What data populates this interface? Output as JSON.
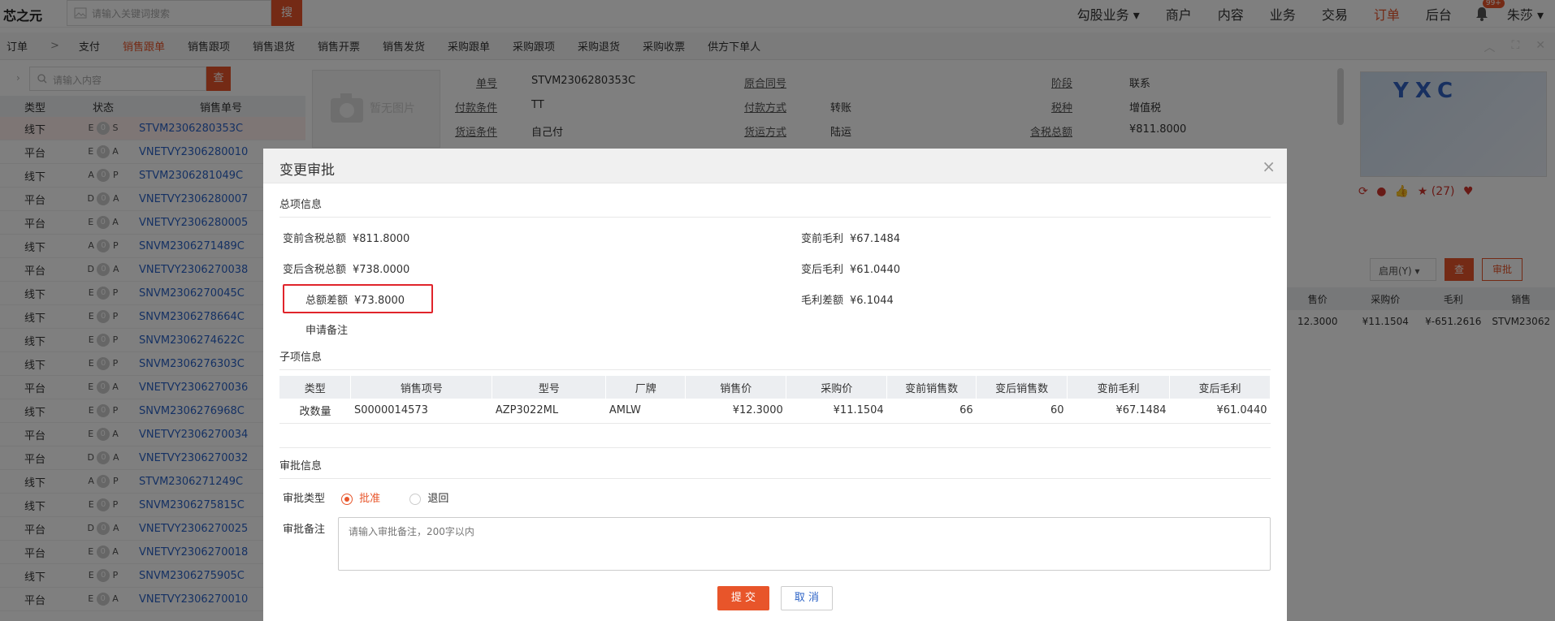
{
  "app": {
    "logo": "芯之元",
    "search_placeholder": "请输入关键词搜索",
    "search_button": "搜",
    "nav": [
      "勾股业务",
      "商户",
      "内容",
      "业务",
      "交易",
      "订单",
      "后台"
    ],
    "active_nav": "订单",
    "bell_badge": "99+",
    "user": "朱莎"
  },
  "tabs": [
    "订单",
    "支付",
    "销售跟单",
    "销售跟项",
    "销售退货",
    "销售开票",
    "销售发货",
    "采购跟单",
    "采购跟项",
    "采购退货",
    "采购收票",
    "供方下单人"
  ],
  "tab_separator": ">",
  "active_tab": "销售跟单",
  "left": {
    "search_placeholder": "请输入内容",
    "search_button": "查",
    "headers": [
      "类型",
      "状态",
      "销售单号"
    ],
    "rows": [
      {
        "type": "线下",
        "s1": "E",
        "s2": "0",
        "s3": "S",
        "no": "STVM2306280353C"
      },
      {
        "type": "平台",
        "s1": "E",
        "s2": "0",
        "s3": "A",
        "no": "VNETVY2306280010"
      },
      {
        "type": "线下",
        "s1": "A",
        "s2": "0",
        "s3": "P",
        "no": "STVM2306281049C"
      },
      {
        "type": "平台",
        "s1": "D",
        "s2": "0",
        "s3": "A",
        "no": "VNETVY2306280007"
      },
      {
        "type": "平台",
        "s1": "E",
        "s2": "0",
        "s3": "A",
        "no": "VNETVY2306280005"
      },
      {
        "type": "线下",
        "s1": "A",
        "s2": "0",
        "s3": "P",
        "no": "SNVM2306271489C"
      },
      {
        "type": "平台",
        "s1": "D",
        "s2": "0",
        "s3": "A",
        "no": "VNETVY2306270038"
      },
      {
        "type": "线下",
        "s1": "E",
        "s2": "0",
        "s3": "P",
        "no": "SNVM2306270045C"
      },
      {
        "type": "线下",
        "s1": "E",
        "s2": "0",
        "s3": "P",
        "no": "SNVM2306278664C"
      },
      {
        "type": "线下",
        "s1": "E",
        "s2": "0",
        "s3": "P",
        "no": "SNVM2306274622C"
      },
      {
        "type": "线下",
        "s1": "E",
        "s2": "0",
        "s3": "P",
        "no": "SNVM2306276303C"
      },
      {
        "type": "平台",
        "s1": "E",
        "s2": "0",
        "s3": "A",
        "no": "VNETVY2306270036"
      },
      {
        "type": "线下",
        "s1": "E",
        "s2": "0",
        "s3": "P",
        "no": "SNVM2306276968C"
      },
      {
        "type": "平台",
        "s1": "E",
        "s2": "0",
        "s3": "A",
        "no": "VNETVY2306270034"
      },
      {
        "type": "平台",
        "s1": "D",
        "s2": "0",
        "s3": "A",
        "no": "VNETVY2306270032"
      },
      {
        "type": "线下",
        "s1": "A",
        "s2": "0",
        "s3": "P",
        "no": "STVM2306271249C"
      },
      {
        "type": "线下",
        "s1": "E",
        "s2": "0",
        "s3": "P",
        "no": "SNVM2306275815C"
      },
      {
        "type": "平台",
        "s1": "D",
        "s2": "0",
        "s3": "A",
        "no": "VNETVY2306270025"
      },
      {
        "type": "平台",
        "s1": "E",
        "s2": "0",
        "s3": "A",
        "no": "VNETVY2306270018"
      },
      {
        "type": "线下",
        "s1": "E",
        "s2": "0",
        "s3": "P",
        "no": "SNVM2306275905C"
      },
      {
        "type": "平台",
        "s1": "E",
        "s2": "0",
        "s3": "A",
        "no": "VNETVY2306270010"
      }
    ]
  },
  "detail": {
    "photo_placeholder": "暂无图片",
    "fields": [
      {
        "k": "单号",
        "v": "STVM2306280353C"
      },
      {
        "k": "原合同号",
        "v": ""
      },
      {
        "k": "阶段",
        "v": "联系"
      },
      {
        "k": "付款条件",
        "v": "TT"
      },
      {
        "k": "付款方式",
        "v": "转账"
      },
      {
        "k": "税种",
        "v": "增值税"
      },
      {
        "k": "货运条件",
        "v": "自己付"
      },
      {
        "k": "货运方式",
        "v": "陆运"
      },
      {
        "k": "含税总额",
        "v": "¥811.8000"
      }
    ],
    "product_brand": "YXC",
    "rating_count": "(27)",
    "status_select": "启用(Y)",
    "query_button": "查",
    "audit_button": "审批",
    "right_table_headers": [
      "售价",
      "采购价",
      "毛利",
      "销售"
    ],
    "right_table_row": [
      "12.3000",
      "¥11.1504",
      "¥-651.2616",
      "STVM23062"
    ]
  },
  "modal": {
    "title": "变更审批",
    "summary_title": "总项信息",
    "before_total_label": "变前含税总额",
    "before_total": "¥811.8000",
    "after_total_label": "变后含税总额",
    "after_total": "¥738.0000",
    "diff_label": "总额差额",
    "diff": "¥73.8000",
    "remark_label": "申请备注",
    "before_margin_label": "变前毛利",
    "before_margin": "¥67.1484",
    "after_margin_label": "变后毛利",
    "after_margin": "¥61.0440",
    "margin_diff_label": "毛利差额",
    "margin_diff": "¥6.1044",
    "sub_title": "子项信息",
    "sub_headers": [
      "类型",
      "销售项号",
      "型号",
      "厂牌",
      "销售价",
      "采购价",
      "变前销售数",
      "变后销售数",
      "变前毛利",
      "变后毛利"
    ],
    "sub_rows": [
      [
        "改数量",
        "S0000014573",
        "AZP3022ML",
        "AMLW",
        "¥12.3000",
        "¥11.1504",
        "66",
        "60",
        "¥67.1484",
        "¥61.0440"
      ]
    ],
    "approval_title": "审批信息",
    "approval_type_label": "审批类型",
    "approve_option": "批准",
    "reject_option": "退回",
    "approval_remark_label": "审批备注",
    "remark_placeholder": "请输入审批备注，200字以内",
    "submit": "提 交",
    "cancel": "取 消"
  }
}
